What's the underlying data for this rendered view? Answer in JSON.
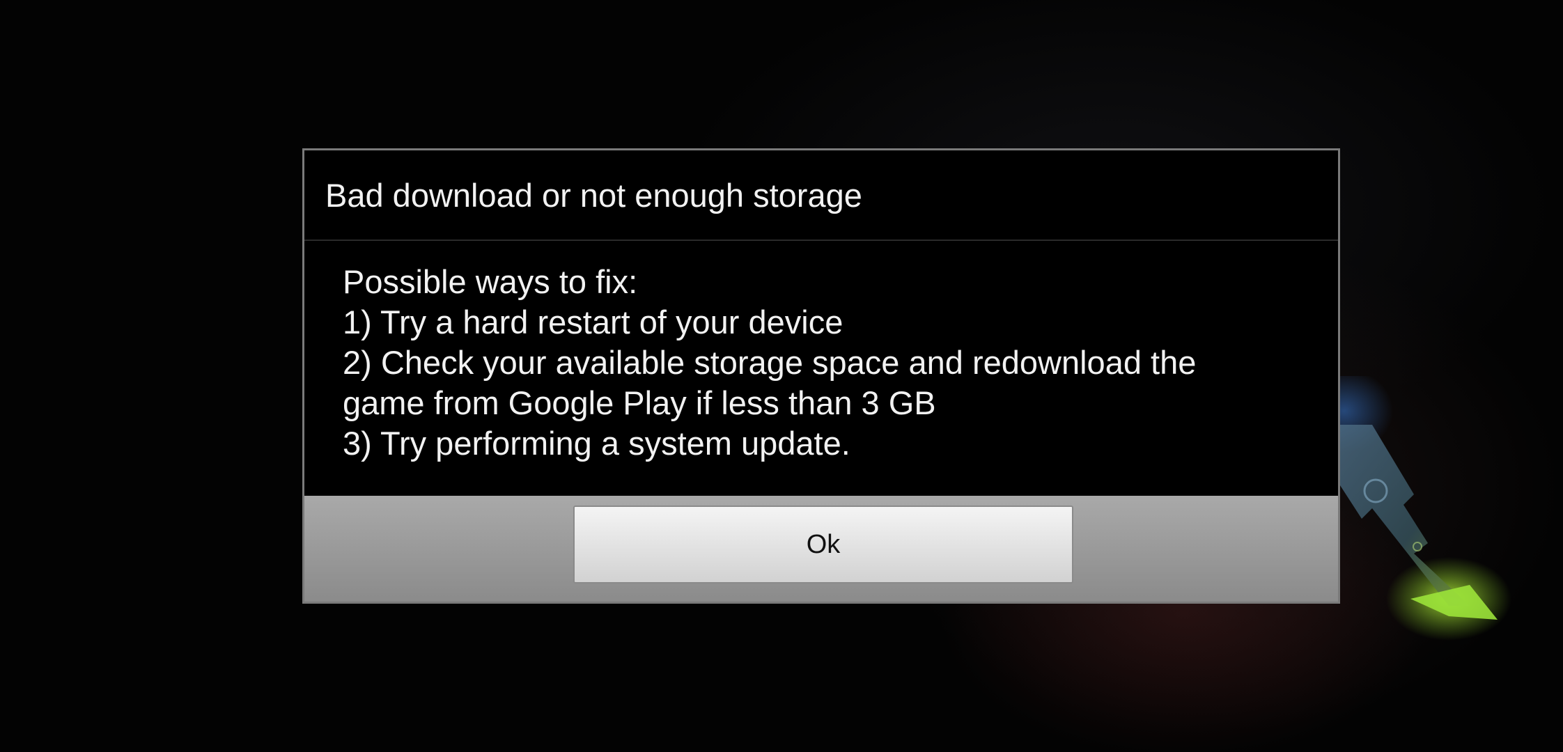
{
  "dialog": {
    "title": "Bad download or not enough storage",
    "body_lines": [
      "Possible ways to fix:",
      "1) Try a hard restart of your device",
      "2) Check your available storage space and redownload the",
      "game from Google Play if less than 3 GB",
      "3) Try performing a system update."
    ],
    "ok_label": "Ok"
  },
  "background": {
    "logo_icon": "ark-logo-icon"
  },
  "colors": {
    "dialog_bg": "#000000",
    "dialog_border": "#7a7a7a",
    "button_bar": "#a0a0a0",
    "button_face": "#e6e6e6",
    "logo_blue": "#3a7bd5",
    "logo_green": "#8bd12a"
  }
}
